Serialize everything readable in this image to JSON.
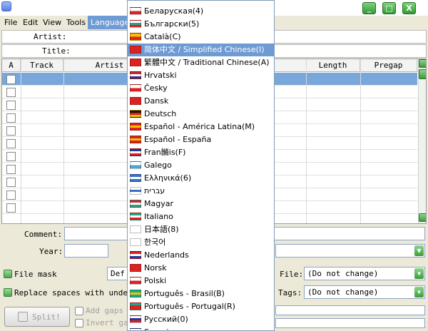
{
  "menubar": {
    "items": [
      "File",
      "Edit",
      "View",
      "Tools",
      "Language"
    ]
  },
  "fields": {
    "artist_label": "Artist:",
    "title_label": "Title:"
  },
  "table": {
    "columns": [
      "A",
      "Track",
      "Artist",
      "Length",
      "Pregap"
    ],
    "rows": 11
  },
  "bottom": {
    "comment_label": "Comment:",
    "year_label": "Year:",
    "file_mask_label": "File mask",
    "default_partial": "Def",
    "file_label": "File:",
    "file_value": "(Do not change)",
    "replace_spaces_label": "Replace spaces with unde",
    "tags_label": "Tags:",
    "tags_value": "(Do not change)",
    "split_label": "Split!",
    "add_gaps_label": "Add gaps",
    "invert_partial": "Invert ga"
  },
  "language_menu": {
    "items": [
      {
        "label": "Беларуская(4)",
        "flag": [
          "#ffffff",
          "#d22"
        ]
      },
      {
        "label": "Български(5)",
        "flag": [
          "#ffffff",
          "#2a8",
          "#d22"
        ]
      },
      {
        "label": "Català(C)",
        "flag": [
          "#f2c400",
          "#d22"
        ]
      },
      {
        "label": "简体中文 / Simplified Chinese(I)",
        "flag": [
          "#d22",
          "#d22"
        ]
      },
      {
        "label": "繁體中文 / Traditional Chinese(A)",
        "flag": [
          "#d22",
          "#d22"
        ]
      },
      {
        "label": "Hrvatski",
        "flag": [
          "#d22",
          "#ffffff",
          "#1e3a9a"
        ]
      },
      {
        "label": "Česky",
        "flag": [
          "#ffffff",
          "#d22"
        ]
      },
      {
        "label": "Dansk",
        "flag": [
          "#d22",
          "#d22"
        ]
      },
      {
        "label": "Deutsch",
        "flag": [
          "#111111",
          "#d22",
          "#f2c400"
        ]
      },
      {
        "label": "Español - América Latina(M)",
        "flag": [
          "#d22",
          "#f2c400",
          "#d22"
        ]
      },
      {
        "label": "Español - España",
        "flag": [
          "#d22",
          "#f2c400",
          "#d22"
        ]
      },
      {
        "label": "Fran鏅is(F)",
        "flag": [
          "#1e3a9a",
          "#ffffff",
          "#d22"
        ]
      },
      {
        "label": "Galego",
        "flag": [
          "#ffffff",
          "#4da3d6"
        ]
      },
      {
        "label": "Ελληνικά(6)",
        "flag": [
          "#3a6fc4",
          "#ffffff",
          "#3a6fc4"
        ]
      },
      {
        "label": "עברית",
        "flag": [
          "#ffffff",
          "#3a6fc4",
          "#ffffff"
        ]
      },
      {
        "label": "Magyar",
        "flag": [
          "#d22",
          "#ffffff",
          "#2a8"
        ]
      },
      {
        "label": "Italiano",
        "flag": [
          "#2a8",
          "#ffffff",
          "#d22"
        ]
      },
      {
        "label": "日本語(8)",
        "flag": [
          "#ffffff",
          "#ffffff"
        ]
      },
      {
        "label": "한국어",
        "flag": [
          "#ffffff",
          "#ffffff"
        ]
      },
      {
        "label": "Nederlands",
        "flag": [
          "#d22",
          "#ffffff",
          "#1e3a9a"
        ]
      },
      {
        "label": "Norsk",
        "flag": [
          "#d22",
          "#d22"
        ]
      },
      {
        "label": "Polski",
        "flag": [
          "#ffffff",
          "#d22"
        ]
      },
      {
        "label": "Português - Brasil(B)",
        "flag": [
          "#2a8",
          "#f2c400",
          "#2a8"
        ]
      },
      {
        "label": "Português - Portugal(R)",
        "flag": [
          "#2a8",
          "#d22",
          "#d22"
        ]
      },
      {
        "label": "Русский(0)",
        "flag": [
          "#ffffff",
          "#1e3a9a",
          "#d22"
        ]
      },
      {
        "label": "Suomi",
        "flag": [
          "#ffffff",
          "#1e3a9a"
        ]
      }
    ],
    "active_index": 3
  }
}
